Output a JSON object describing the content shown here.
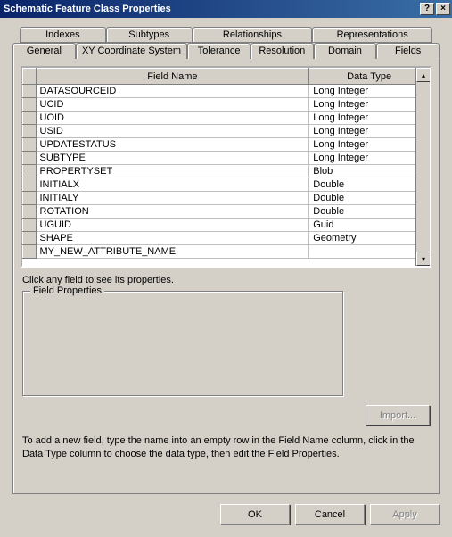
{
  "window": {
    "title": "Schematic Feature Class Properties"
  },
  "tabs": {
    "row1": [
      "Indexes",
      "Subtypes",
      "Relationships",
      "Representations"
    ],
    "row2": [
      "General",
      "XY Coordinate System",
      "Tolerance",
      "Resolution",
      "Domain",
      "Fields"
    ],
    "active": "Fields"
  },
  "grid": {
    "headers": {
      "fieldname": "Field Name",
      "datatype": "Data Type"
    },
    "rows": [
      {
        "name": "DATASOURCEID",
        "type": "Long Integer"
      },
      {
        "name": "UCID",
        "type": "Long Integer"
      },
      {
        "name": "UOID",
        "type": "Long Integer"
      },
      {
        "name": "USID",
        "type": "Long Integer"
      },
      {
        "name": "UPDATESTATUS",
        "type": "Long Integer"
      },
      {
        "name": "SUBTYPE",
        "type": "Long Integer"
      },
      {
        "name": "PROPERTYSET",
        "type": "Blob"
      },
      {
        "name": "INITIALX",
        "type": "Double"
      },
      {
        "name": "INITIALY",
        "type": "Double"
      },
      {
        "name": "ROTATION",
        "type": "Double"
      },
      {
        "name": "UGUID",
        "type": "Guid"
      },
      {
        "name": "SHAPE",
        "type": "Geometry"
      }
    ],
    "editing": {
      "name": "MY_NEW_ATTRIBUTE_NAME",
      "type": ""
    }
  },
  "hint": "Click any field to see its properties.",
  "groupbox": {
    "title": "Field Properties"
  },
  "import_label": "Import...",
  "helptext": "To add a new field, type the name into an empty row in the Field Name column, click in the Data Type column to choose the data type, then edit the Field Properties.",
  "buttons": {
    "ok": "OK",
    "cancel": "Cancel",
    "apply": "Apply"
  }
}
